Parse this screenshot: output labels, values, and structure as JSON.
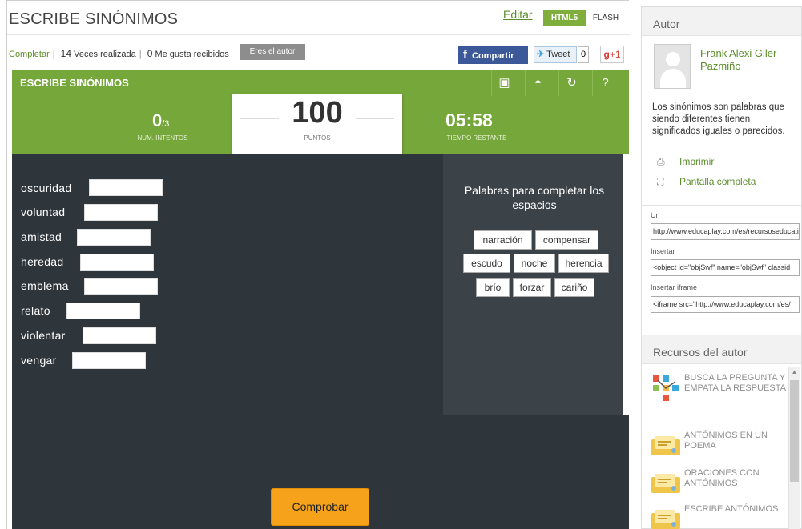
{
  "header": {
    "title": "ESCRIBE SINÓNIMOS",
    "edit_link": "Editar",
    "tab_html5": "HTML5",
    "tab_flash": "FLASH"
  },
  "meta": {
    "type_link": "Completar",
    "times_count": "14",
    "times_label": "Veces realizada",
    "likes_count": "0",
    "likes_label": "Me gusta recibidos",
    "author_button": "Eres el autor"
  },
  "social": {
    "share_label": "Compartir",
    "tweet_label": "Tweet",
    "tweet_count": "0",
    "gplus_label": "+1"
  },
  "game": {
    "name": "ESCRIBE SINÓNIMOS",
    "attempts_value": "0",
    "attempts_max": "/3",
    "attempts_label": "NUM. INTENTOS",
    "points_value": "100",
    "points_label": "PUNTOS",
    "time_value": "05:58",
    "time_label": "TIEMPO RESTANTE",
    "words": [
      "oscuridad",
      "voluntad",
      "amistad",
      "heredad",
      "emblema",
      "relato",
      "violentar",
      "vengar"
    ],
    "palette_title": "Palabras para completar los espacios",
    "chips": [
      "narración",
      "compensar",
      "escudo",
      "noche",
      "herencia",
      "brío",
      "forzar",
      "cariño"
    ],
    "check_button": "Comprobar",
    "tool_icons": [
      "screenshot-icon",
      "audio-icon",
      "restart-icon",
      "help-icon"
    ]
  },
  "author_panel": {
    "heading": "Autor",
    "name": "Frank Alexi Giler Pazmiño",
    "description": "Los sinónimos son palabras que siendo diferentes tienen significados iguales o parecidos.",
    "print_label": "Imprimir",
    "fullscreen_label": "Pantalla completa",
    "url_label": "Url",
    "url_value": "http://www.educaplay.com/es/recursoseducativos",
    "embed_label": "Insertar",
    "embed_value": "<object id=\"objSwf\" name=\"objSwf\" classid",
    "iframe_label": "Insertar iframe",
    "iframe_value": "<iframe src=\"http://www.educaplay.com/es/"
  },
  "resources_panel": {
    "heading": "Recursos del autor",
    "items": [
      "BUSCA LA PREGUNTA Y EMPATA LA RESPUESTA",
      "ANTÓNIMOS EN UN POEMA",
      "ORACIONES CON ANTÓNIMOS",
      "ESCRIBE ANTÓNIMOS"
    ]
  }
}
